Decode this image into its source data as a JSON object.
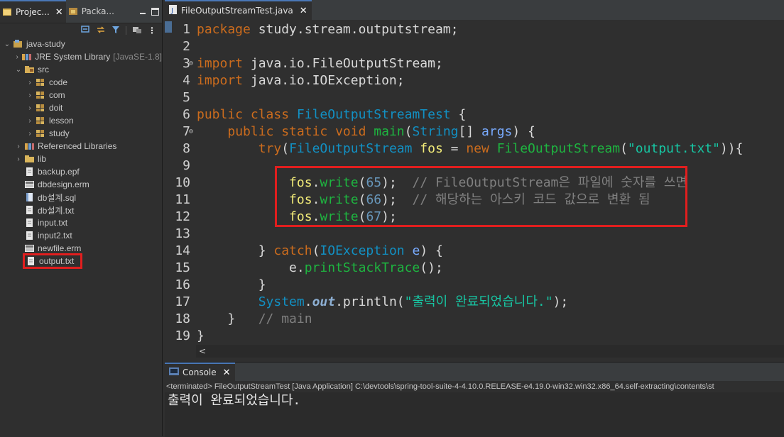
{
  "left_panel": {
    "tabs": [
      {
        "label": "Projec...",
        "close": "✕"
      },
      {
        "label": "Packa..."
      }
    ],
    "tree": [
      {
        "label": "java-study",
        "indent": 0,
        "expanded": true
      },
      {
        "label": "JRE System Library",
        "sub": "[JavaSE-1.8]",
        "indent": 1
      },
      {
        "label": "src",
        "indent": 1,
        "expanded": true
      },
      {
        "label": "code",
        "indent": 2
      },
      {
        "label": "com",
        "indent": 2
      },
      {
        "label": "doit",
        "indent": 2
      },
      {
        "label": "lesson",
        "indent": 2
      },
      {
        "label": "study",
        "indent": 2
      },
      {
        "label": "Referenced Libraries",
        "indent": 1
      },
      {
        "label": "lib",
        "indent": 1
      },
      {
        "label": "backup.epf",
        "indent": 1
      },
      {
        "label": "dbdesign.erm",
        "indent": 1
      },
      {
        "label": "db설계.sql",
        "indent": 1
      },
      {
        "label": "db설계.txt",
        "indent": 1
      },
      {
        "label": "input.txt",
        "indent": 1
      },
      {
        "label": "input2.txt",
        "indent": 1
      },
      {
        "label": "newfile.erm",
        "indent": 1
      },
      {
        "label": "output.txt",
        "indent": 1
      }
    ]
  },
  "editor": {
    "tab_label": "FileOutputStreamTest.java",
    "tab_close": "✕",
    "lines": [
      {
        "n": "1",
        "fold": ""
      },
      {
        "n": "2",
        "fold": ""
      },
      {
        "n": "3",
        "fold": "⊖"
      },
      {
        "n": "4",
        "fold": ""
      },
      {
        "n": "5",
        "fold": ""
      },
      {
        "n": "6",
        "fold": ""
      },
      {
        "n": "7",
        "fold": "⊖"
      },
      {
        "n": "8",
        "fold": ""
      },
      {
        "n": "9",
        "fold": ""
      },
      {
        "n": "10",
        "fold": ""
      },
      {
        "n": "11",
        "fold": ""
      },
      {
        "n": "12",
        "fold": ""
      },
      {
        "n": "13",
        "fold": ""
      },
      {
        "n": "14",
        "fold": ""
      },
      {
        "n": "15",
        "fold": ""
      },
      {
        "n": "16",
        "fold": ""
      },
      {
        "n": "17",
        "fold": ""
      },
      {
        "n": "18",
        "fold": ""
      },
      {
        "n": "19",
        "fold": ""
      }
    ],
    "scroll_left": "<"
  },
  "console": {
    "tab_label": "Console",
    "tab_close": "✕",
    "status": "<terminated> FileOutputStreamTest [Java Application] C:\\devtools\\spring-tool-suite-4-4.10.0.RELEASE-e4.19.0-win32.win32.x86_64.self-extracting\\contents\\st",
    "output": "출력이 완료되었습니다."
  },
  "colors": {
    "highlight_border": "#e11e1e",
    "keyword": "#cc6c1d",
    "class": "#1290c3",
    "string": "#17c6a3",
    "comment": "#808080",
    "method": "#1eb540"
  }
}
